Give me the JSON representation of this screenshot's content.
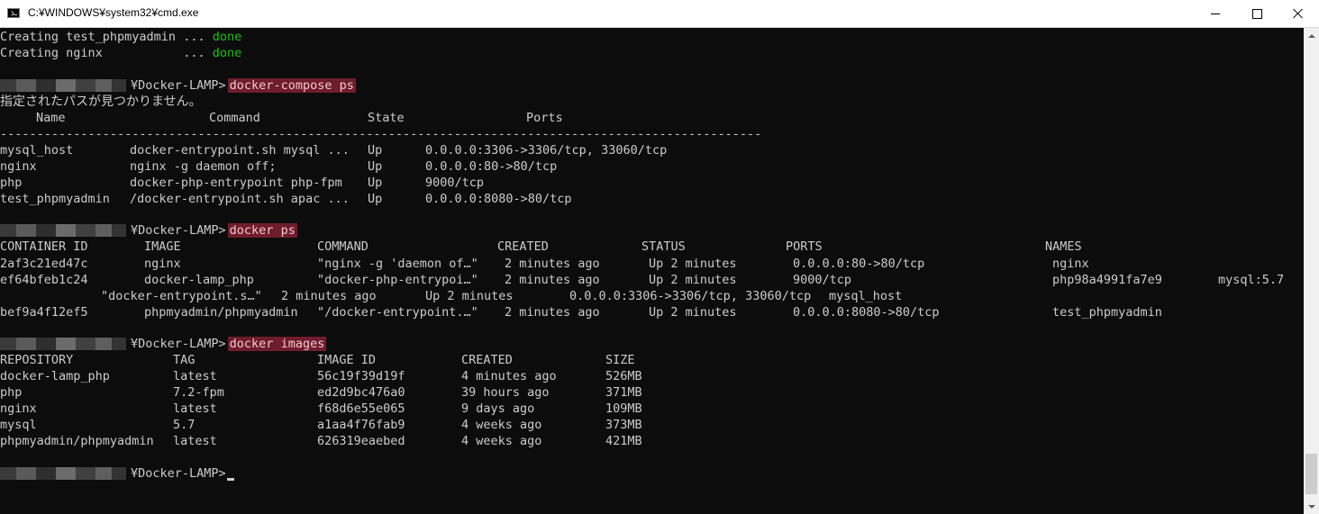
{
  "window": {
    "title": "C:¥WINDOWS¥system32¥cmd.exe",
    "icons": [
      "cmd-app-icon",
      "minimize-icon",
      "maximize-icon",
      "close-icon"
    ]
  },
  "console": {
    "colors": {
      "background": "#0c0c0c",
      "text": "#cccccc",
      "done": "#16c60c",
      "command_highlight": "#6f1c2c"
    },
    "creating": [
      {
        "text": "Creating test_phpmyadmin ... ",
        "status": "done"
      },
      {
        "text": "Creating nginx           ... ",
        "status": "done"
      }
    ],
    "prompt": "¥Docker-LAMP>",
    "cmd1": "docker-compose ps",
    "error_msg": "指定されたパスが見つかりません。",
    "compose": {
      "headers": [
        "Name",
        "Command",
        "State",
        "Ports"
      ],
      "separator": "--------------------------------------------------------------------------------------------------------",
      "rows": [
        [
          "mysql_host",
          "docker-entrypoint.sh mysql ...",
          "Up",
          "0.0.0.0:3306->3306/tcp, 33060/tcp"
        ],
        [
          "nginx",
          "nginx -g daemon off;",
          "Up",
          "0.0.0.0:80->80/tcp"
        ],
        [
          "php",
          "docker-php-entrypoint php-fpm",
          "Up",
          "9000/tcp"
        ],
        [
          "test_phpmyadmin",
          "/docker-entrypoint.sh apac ...",
          "Up",
          "0.0.0.0:8080->80/tcp"
        ]
      ]
    },
    "cmd2": "docker ps",
    "ps": {
      "headers": [
        "CONTAINER ID",
        "IMAGE",
        "COMMAND",
        "CREATED",
        "STATUS",
        "PORTS",
        "NAMES"
      ],
      "row1": [
        "2af3c21ed47c",
        "nginx",
        "\"nginx -g 'daemon of…\"",
        "2 minutes ago",
        "Up 2 minutes",
        "0.0.0.0:80->80/tcp",
        "nginx"
      ],
      "row2": [
        "ef64bfeb1c24",
        "docker-lamp_php",
        "\"docker-php-entrypoi…\"",
        "2 minutes ago",
        "Up 2 minutes",
        "9000/tcp",
        "php98a4991fa7e9",
        "mysql:5.7"
      ],
      "row2_wrap": [
        "\"docker-entrypoint.s…\"",
        "2 minutes ago",
        "Up 2 minutes",
        "0.0.0.0:3306->3306/tcp, 33060/tcp",
        "mysql_host"
      ],
      "row3": [
        "bef9a4f12ef5",
        "phpmyadmin/phpmyadmin",
        "\"/docker-entrypoint.…\"",
        "2 minutes ago",
        "Up 2 minutes",
        "0.0.0.0:8080->80/tcp",
        "test_phpmyadmin"
      ]
    },
    "cmd3": "docker images",
    "images": {
      "headers": [
        "REPOSITORY",
        "TAG",
        "IMAGE ID",
        "CREATED",
        "SIZE"
      ],
      "rows": [
        [
          "docker-lamp_php",
          "latest",
          "56c19f39d19f",
          "4 minutes ago",
          "526MB"
        ],
        [
          "php",
          "7.2-fpm",
          "ed2d9bc476a0",
          "39 hours ago",
          "371MB"
        ],
        [
          "nginx",
          "latest",
          "f68d6e55e065",
          "9 days ago",
          "109MB"
        ],
        [
          "mysql",
          "5.7",
          "a1aa4f76fab9",
          "4 weeks ago",
          "373MB"
        ],
        [
          "phpmyadmin/phpmyadmin",
          "latest",
          "626319eaebed",
          "4 weeks ago",
          "421MB"
        ]
      ]
    }
  }
}
